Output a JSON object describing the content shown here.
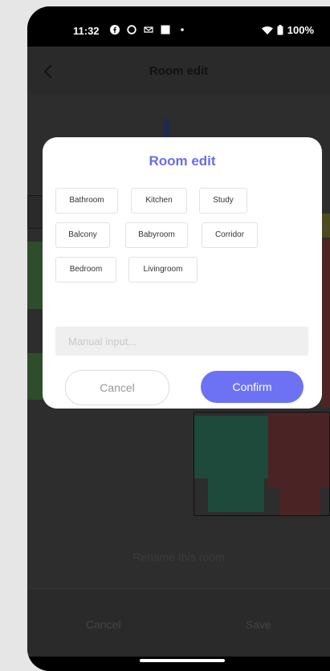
{
  "status_bar": {
    "time": "11:32",
    "battery": "100%"
  },
  "header": {
    "title": "Room edit"
  },
  "dialog": {
    "title": "Room edit",
    "chips": [
      "Bathroom",
      "Kitchen",
      "Study",
      "Balcony",
      "Babyroom",
      "Corridor",
      "Bedroom",
      "Livingroom"
    ],
    "manual_placeholder": "Manual input...",
    "cancel_label": "Cancel",
    "confirm_label": "Confirm"
  },
  "map": {
    "hint": "Rename this room"
  },
  "bottom": {
    "cancel_label": "Cancel",
    "save_label": "Save"
  },
  "colors": {
    "accent": "#6d72f5",
    "title": "#6a6cf0"
  }
}
